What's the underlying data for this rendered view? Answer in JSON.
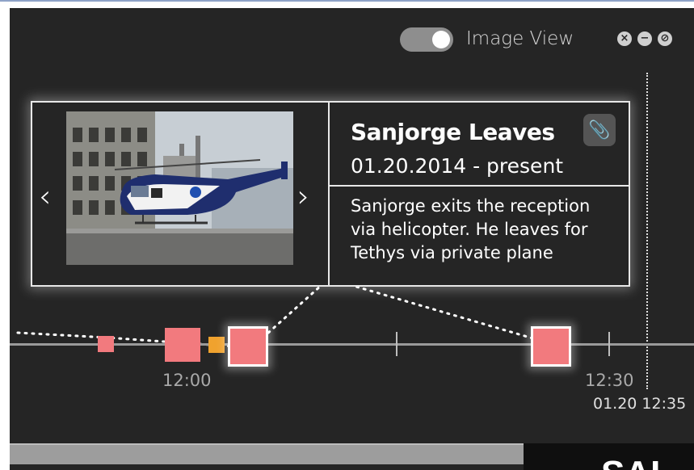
{
  "toggle": {
    "label": "Image View",
    "state": "on"
  },
  "window_controls": {
    "close": "×",
    "minimize": "−",
    "disable": "⊘"
  },
  "event": {
    "title": "Sanjorge Leaves",
    "date_range": "01.20.2014 - present",
    "description": "Sanjorge exits the reception via helicopter. He leaves for Tethys via private plane",
    "attachment_icon": "paperclip-icon",
    "prev_icon": "chevron-left-icon",
    "next_icon": "chevron-right-icon",
    "nav_prev": "‹",
    "nav_next": "›",
    "attach_glyph": "📎"
  },
  "timeline": {
    "tick_labels": [
      "12:00",
      "12:30"
    ],
    "now_label": "01.20 12:35"
  },
  "corner_text": "SAL",
  "colors": {
    "event": "#f27a7e",
    "event_alt": "#f0a22e",
    "background": "#252525"
  }
}
